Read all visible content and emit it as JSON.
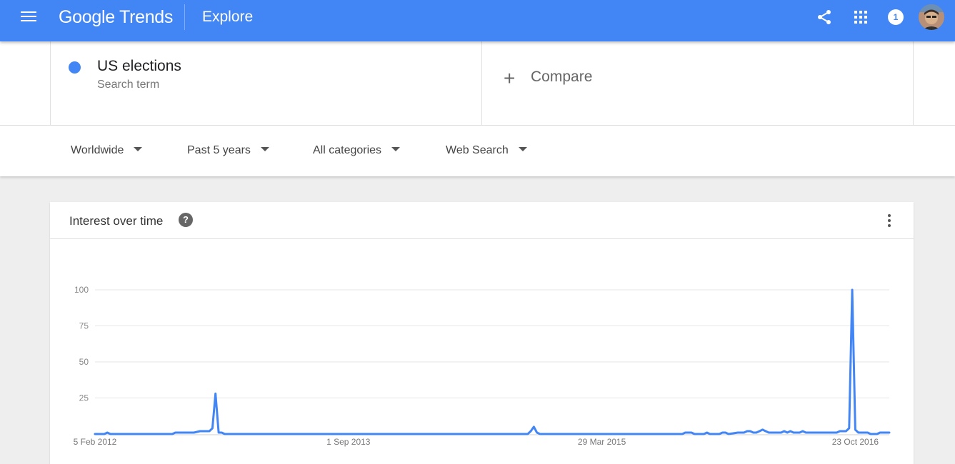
{
  "header": {
    "logo_google": "Google",
    "logo_trends": "Trends",
    "section": "Explore",
    "notification_count": "1",
    "icons": [
      "menu-icon",
      "share-icon",
      "apps-icon",
      "notification-icon",
      "avatar"
    ]
  },
  "search_term": {
    "name": "US elections",
    "type": "Search term",
    "color": "#4285f4"
  },
  "compare": {
    "label": "Compare"
  },
  "filters": {
    "region": "Worldwide",
    "time": "Past 5 years",
    "category": "All categories",
    "search_type": "Web Search"
  },
  "chart_card": {
    "title": "Interest over time"
  },
  "colors": {
    "brand": "#4285f4",
    "series": "#4285f4",
    "grid": "#e6e6e6"
  },
  "chart_data": {
    "type": "line",
    "title": "Interest over time",
    "xlabel": "",
    "ylabel": "",
    "ylim": [
      0,
      100
    ],
    "yticks": [
      25,
      50,
      75,
      100
    ],
    "xtick_labels": [
      {
        "label": "5 Feb 2012",
        "week": 0
      },
      {
        "label": "1 Sep 2013",
        "week": 82
      },
      {
        "label": "29 Mar 2015",
        "week": 164
      },
      {
        "label": "23 Oct 2016",
        "week": 246
      }
    ],
    "grid": true,
    "series": [
      {
        "name": "US elections",
        "points": [
          [
            0,
            0
          ],
          [
            3,
            0
          ],
          [
            4,
            1
          ],
          [
            5,
            0
          ],
          [
            25,
            0
          ],
          [
            26,
            1
          ],
          [
            32,
            1
          ],
          [
            34,
            2
          ],
          [
            37,
            2
          ],
          [
            38,
            4
          ],
          [
            39,
            28
          ],
          [
            40,
            1
          ],
          [
            41,
            1
          ],
          [
            42,
            0
          ],
          [
            140,
            0
          ],
          [
            141,
            2
          ],
          [
            142,
            5
          ],
          [
            143,
            1
          ],
          [
            144,
            0
          ],
          [
            190,
            0
          ],
          [
            191,
            1
          ],
          [
            193,
            1
          ],
          [
            194,
            0
          ],
          [
            197,
            0
          ],
          [
            198,
            1
          ],
          [
            199,
            0
          ],
          [
            202,
            0
          ],
          [
            203,
            1
          ],
          [
            204,
            1
          ],
          [
            205,
            0
          ],
          [
            208,
            1
          ],
          [
            210,
            1
          ],
          [
            211,
            2
          ],
          [
            212,
            2
          ],
          [
            213,
            1
          ],
          [
            214,
            1
          ],
          [
            215,
            2
          ],
          [
            216,
            3
          ],
          [
            217,
            2
          ],
          [
            218,
            1
          ],
          [
            219,
            1
          ],
          [
            221,
            1
          ],
          [
            222,
            1
          ],
          [
            223,
            2
          ],
          [
            224,
            1
          ],
          [
            225,
            2
          ],
          [
            226,
            1
          ],
          [
            227,
            1
          ],
          [
            228,
            1
          ],
          [
            229,
            2
          ],
          [
            230,
            1
          ],
          [
            240,
            1
          ],
          [
            241,
            2
          ],
          [
            242,
            2
          ],
          [
            243,
            2
          ],
          [
            244,
            4
          ],
          [
            245,
            100
          ],
          [
            246,
            3
          ],
          [
            247,
            1
          ],
          [
            248,
            1
          ],
          [
            249,
            1
          ],
          [
            250,
            1
          ],
          [
            251,
            0
          ],
          [
            253,
            0
          ],
          [
            254,
            1
          ],
          [
            256,
            1
          ],
          [
            257,
            1
          ]
        ]
      }
    ]
  }
}
